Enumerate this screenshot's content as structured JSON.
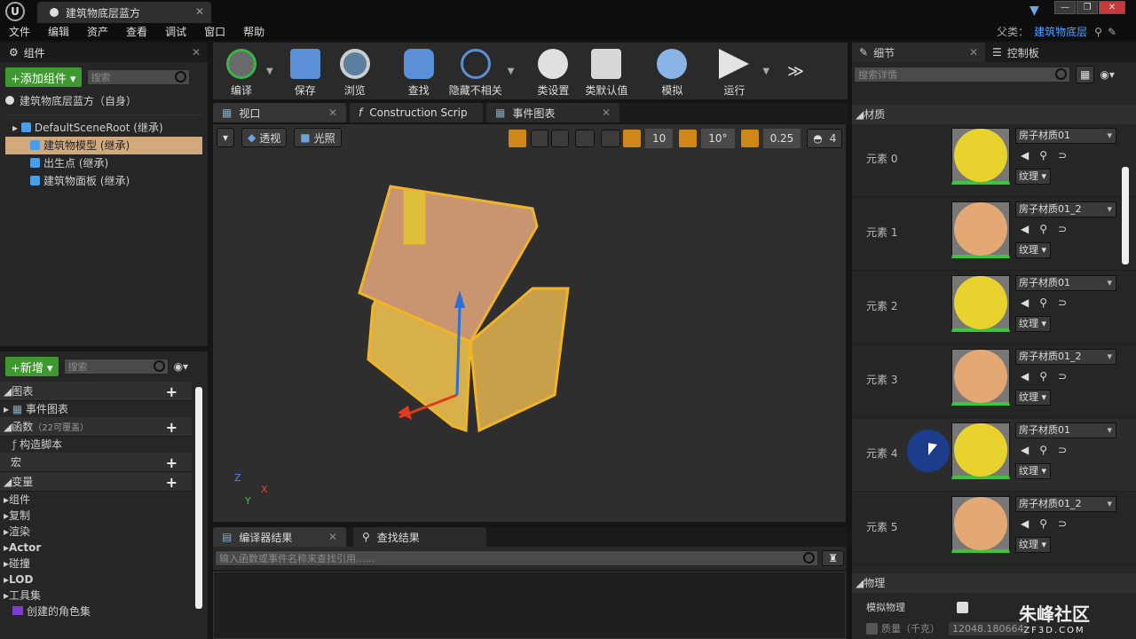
{
  "app": {
    "logo": "U",
    "doc_tab": "建筑物底层蓝方"
  },
  "menu": [
    "文件",
    "编辑",
    "资产",
    "查看",
    "调试",
    "窗口",
    "帮助"
  ],
  "parent": {
    "label": "父类：",
    "value": "建筑物底层"
  },
  "components": {
    "tab": "组件",
    "add_label": "+添加组件 ▾",
    "search_placeholder": "搜索",
    "self_item": "建筑物底层蓝方（自身）",
    "tree": [
      "DefaultSceneRoot (继承)",
      "建筑物模型 (继承)",
      "出生点 (继承)",
      "建筑物面板 (继承)"
    ]
  },
  "mybp": {
    "new_label": "+新增 ▾",
    "search_placeholder": "搜索",
    "graphs_header": "图表",
    "event_graph": "事件图表",
    "functions_header": "函数",
    "functions_note": "（22可覆盖）",
    "construction_script": "构造脚本",
    "macros_header": "宏",
    "variables_header": "变量",
    "var_groups": [
      "组件",
      "复制",
      "渲染",
      "Actor",
      "碰撞",
      "LOD",
      "工具集"
    ],
    "character_set": "创建的角色集"
  },
  "toolbar": [
    "编译",
    "保存",
    "浏览",
    "查找",
    "隐藏不相关",
    "类设置",
    "类默认值",
    "模拟",
    "运行"
  ],
  "viewport_tabs": [
    "视口",
    "Construction Scrip",
    "事件图表"
  ],
  "viewport": {
    "perspective": "透视",
    "lit": "光照",
    "grid": "10",
    "angle": "10°",
    "scale": "0.25",
    "speed": "4"
  },
  "bottom": {
    "tabs": [
      "编译器结果",
      "查找结果"
    ],
    "search_placeholder": "输入函数或事件名称来查找引用......"
  },
  "details": {
    "tab_details": "细节",
    "tab_control": "控制板",
    "search_placeholder": "搜索详情",
    "materials_header": "材质",
    "elements": [
      {
        "label": "元素 0",
        "material": "房子材质01",
        "color": "#e8d22e"
      },
      {
        "label": "元素 1",
        "material": "房子材质01_2",
        "color": "#e3a873"
      },
      {
        "label": "元素 2",
        "material": "房子材质01",
        "color": "#e8d22e"
      },
      {
        "label": "元素 3",
        "material": "房子材质01_2",
        "color": "#e3a873"
      },
      {
        "label": "元素 4",
        "material": "房子材质01",
        "color": "#e8d22e"
      },
      {
        "label": "元素 5",
        "material": "房子材质01_2",
        "color": "#e3a873"
      }
    ],
    "texture_label": "纹理 ▾",
    "physics_header": "物理",
    "simulate_physics": "模拟物理",
    "mass_label": "质量（千克）",
    "mass_value": "12048.180664"
  },
  "watermark": {
    "name": "朱峰社区",
    "url": "ZF3D.COM"
  }
}
